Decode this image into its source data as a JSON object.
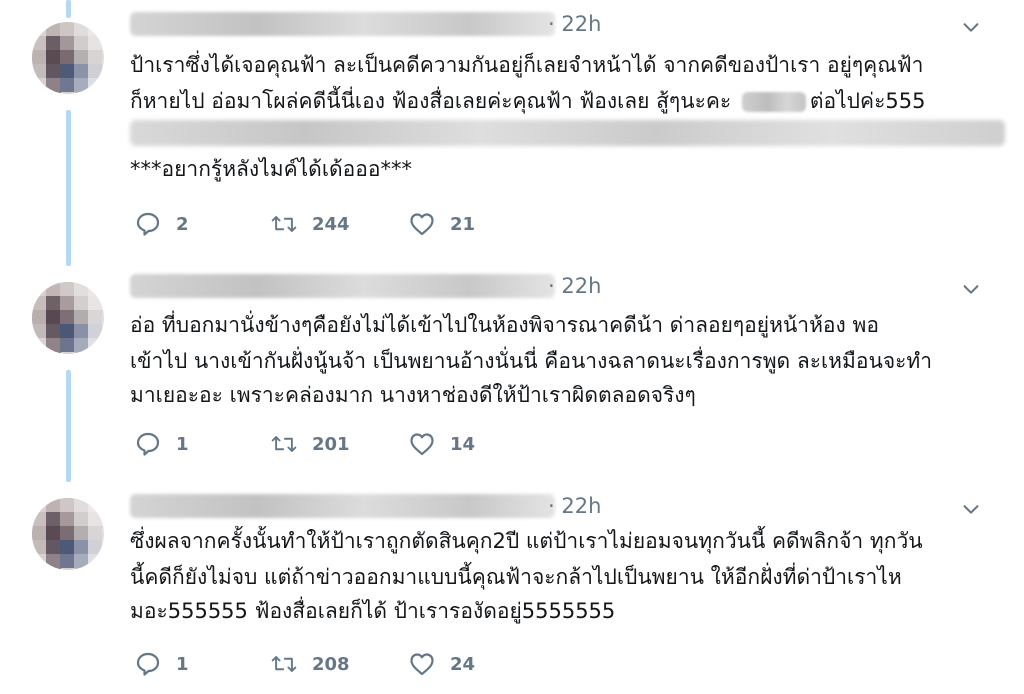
{
  "tweets": [
    {
      "time": "· 22h",
      "lines": [
        "ป้าเราซึ่งได้เจอคุณฟ้า ละเป็นคดีความกันอยู่ก็เลยจำหน้าได้ จากคดีของป้าเรา อยู่ๆคุณฟ้า",
        "ก็หายไป อ่อมาโผล่คดีนี้นี่เอง ฟ้องสื่อเลยค่ะคุณฟ้า ฟ้องเลย สู้ๆนะคะ",
        "ต่อไปค่ะ555",
        "***อยากรู้หลังไมค์ได้เด้อออ***"
      ],
      "replies": "2",
      "retweets": "244",
      "likes": "21"
    },
    {
      "time": "· 22h",
      "lines": [
        "อ่อ ที่บอกมานั่งข้างๆคือยังไม่ได้เข้าไปในห้องพิจารณาคดีน้า ด่าลอยๆอยู่หน้าห้อง พอ",
        "เข้าไป นางเข้ากันฝั่งนู้นจ้า เป็นพยานอ้างนั่นนี่ คือนางฉลาดนะเรื่องการพูด ละเหมือนจะทำ",
        "มาเยอะอะ เพราะคล่องมาก นางหาช่องดีให้ป้าเราผิดตลอดจริงๆ"
      ],
      "replies": "1",
      "retweets": "201",
      "likes": "14"
    },
    {
      "time": "· 22h",
      "lines": [
        "ซึ่งผลจากครั้งนั้นทำให้ป้าเราถูกตัดสินคุก2ปี แต่ป้าเราไม่ยอมจนทุกวันนี้ คดีพลิกจ้า ทุกวัน",
        "นี้คดีก็ยังไม่จบ แต่ถ้าข่าวออกมาแบบนี้คุณฟ้าจะกล้าไปเป็นพยาน ให้อีกฝั่งที่ด่าป้าเราไห",
        "มอะ555555 ฟ้องสื่อเลยก็ได้ ป้าเรารองัดอยู่5555555"
      ],
      "replies": "1",
      "retweets": "208",
      "likes": "24"
    }
  ],
  "icons": {
    "reply": "reply-icon",
    "retweet": "retweet-icon",
    "like": "heart-icon",
    "more": "chevron-down-icon"
  },
  "colors": {
    "thread_line": "#b4d8f5",
    "meta_gray": "#657786",
    "text": "#14171a"
  }
}
